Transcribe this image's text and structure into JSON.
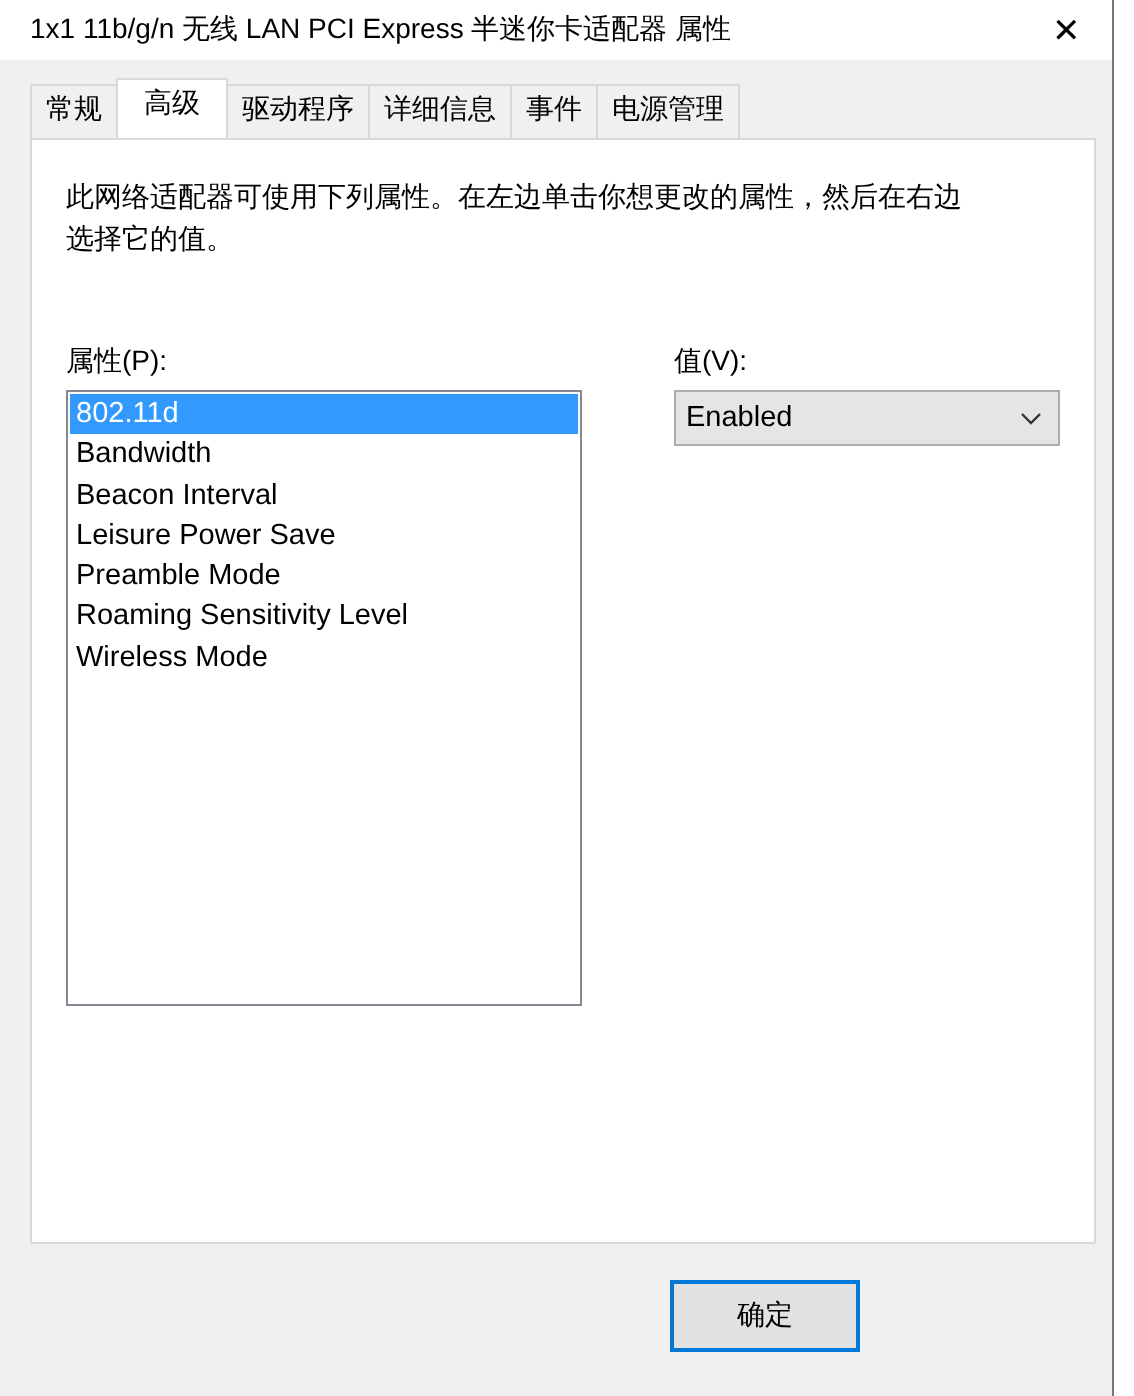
{
  "window": {
    "title": "1x1 11b/g/n 无线 LAN PCI Express 半迷你卡适配器 属性",
    "close": "✕"
  },
  "tabs": [
    {
      "label": "常规",
      "selected": false
    },
    {
      "label": "高级",
      "selected": true
    },
    {
      "label": "驱动程序",
      "selected": false
    },
    {
      "label": "详细信息",
      "selected": false
    },
    {
      "label": "事件",
      "selected": false
    },
    {
      "label": "电源管理",
      "selected": false
    }
  ],
  "description": "此网络适配器可使用下列属性。在左边单击你想更改的属性，然后在右边选择它的值。",
  "property_label": "属性(P):",
  "properties": [
    {
      "label": "802.11d",
      "selected": true
    },
    {
      "label": "Bandwidth",
      "selected": false
    },
    {
      "label": "Beacon Interval",
      "selected": false
    },
    {
      "label": "Leisure Power Save",
      "selected": false
    },
    {
      "label": "Preamble Mode",
      "selected": false
    },
    {
      "label": "Roaming Sensitivity Level",
      "selected": false
    },
    {
      "label": "Wireless Mode",
      "selected": false
    }
  ],
  "value_label": "值(V):",
  "value": "Enabled",
  "buttons": [
    "确定"
  ]
}
